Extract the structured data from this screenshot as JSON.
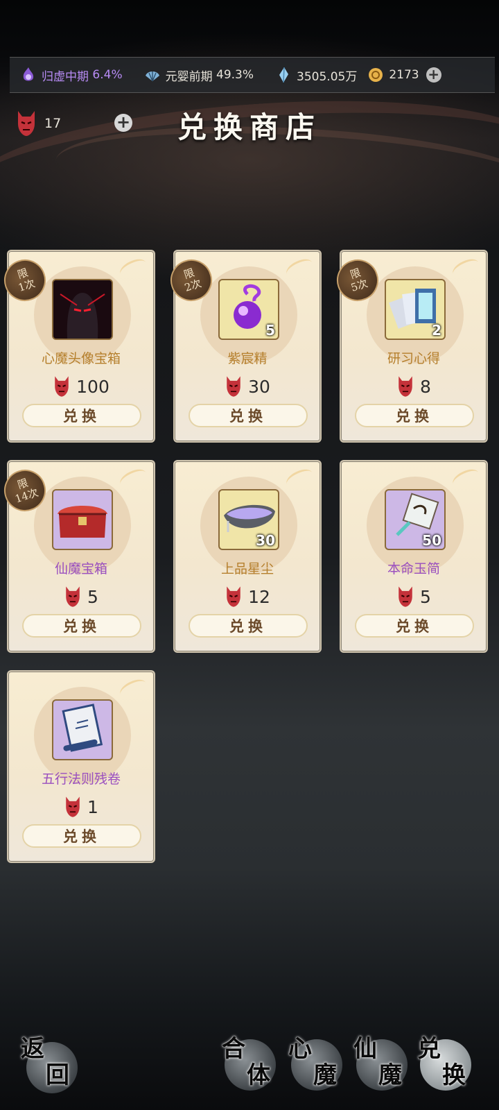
{
  "header": {
    "stats": [
      {
        "label": "归虚中期",
        "value": "6.4%",
        "icon": "purple-flame-icon",
        "color": "#b78bf4"
      },
      {
        "label": "元婴前期",
        "value": "49.3%",
        "icon": "fan-icon",
        "color": "#e8e4da"
      },
      {
        "label": "3505.05万",
        "value": "",
        "icon": "spirit-crystal-icon",
        "color": "#e8e4da"
      },
      {
        "label": "2173",
        "value": "",
        "icon": "gold-coin-icon",
        "color": "#e8e4da"
      }
    ],
    "add_symbol": "+"
  },
  "currency": {
    "icon": "demon-mask-icon",
    "amount": "17",
    "add_symbol": "+"
  },
  "title": "兑换商店",
  "items": [
    {
      "name": "心魔头像宝箱",
      "price": "100",
      "qty": "",
      "limit_top": "限",
      "limit_bottom": "1次",
      "button": "兑换",
      "icon": "demon-avatar-chest-icon",
      "name_color": "gold"
    },
    {
      "name": "紫宸精",
      "price": "30",
      "qty": "5",
      "limit_top": "限",
      "limit_bottom": "2次",
      "button": "兑换",
      "icon": "purple-orb-icon",
      "name_color": "gold"
    },
    {
      "name": "研习心得",
      "price": "8",
      "qty": "2",
      "limit_top": "限",
      "limit_bottom": "5次",
      "button": "兑换",
      "icon": "study-cards-icon",
      "name_color": "gold"
    },
    {
      "name": "仙魔宝箱",
      "price": "5",
      "qty": "",
      "limit_top": "限",
      "limit_bottom": "14次",
      "button": "兑换",
      "icon": "red-chest-icon",
      "name_color": "purple"
    },
    {
      "name": "上品星尘",
      "price": "12",
      "qty": "30",
      "limit_top": "",
      "limit_bottom": "",
      "button": "兑换",
      "icon": "stardust-icon",
      "name_color": "gold"
    },
    {
      "name": "本命玉简",
      "price": "5",
      "qty": "50",
      "limit_top": "",
      "limit_bottom": "",
      "button": "兑换",
      "icon": "jade-slip-icon",
      "name_color": "purple"
    },
    {
      "name": "五行法则残卷",
      "price": "1",
      "qty": "",
      "limit_top": "",
      "limit_bottom": "",
      "button": "兑换",
      "icon": "scroll-icon",
      "name_color": "purple"
    }
  ],
  "nav": {
    "back": [
      "返",
      "回"
    ],
    "tabs": [
      {
        "top": "合",
        "bottom": "体"
      },
      {
        "top": "心",
        "bottom": "魔"
      },
      {
        "top": "仙",
        "bottom": "魔"
      },
      {
        "top": "兑",
        "bottom": "换"
      }
    ]
  }
}
